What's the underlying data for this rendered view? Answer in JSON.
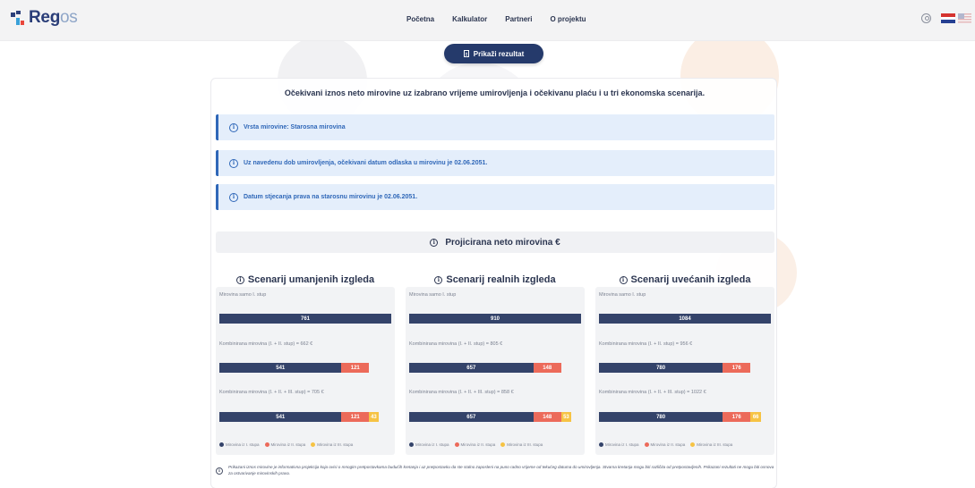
{
  "brand": {
    "logo_part1": "Reg",
    "logo_part2": "os"
  },
  "nav": [
    "Početna",
    "Kalkulator",
    "Partneri",
    "O projektu"
  ],
  "header_icons": [
    "user-icon",
    "flag-hr-icon",
    "flag-en-icon"
  ],
  "result_button": {
    "label": "Prikaži rezultat",
    "icon": "document-icon"
  },
  "intro": "Očekivani iznos neto mirovine uz izabrano vrijeme umirovljenja i očekivanu plaću i u tri ekonomska scenarija.",
  "info_boxes": [
    "Vrsta mirovine: Starosna mirovina",
    "Uz navedenu dob umirovljenja, očekivani datum odlaska u mirovinu je 02.06.2051.",
    "Datum stjecanja prava na starosnu mirovinu je 02.06.2051."
  ],
  "projection_title": "Projicirana neto mirovina €",
  "scenarios": [
    {
      "title": "Scenarij umanjenih izgleda",
      "row1_label": "Mirovina samo I. stup",
      "row1": [
        761
      ],
      "row2_label": "Kombinirana mirovina (I. + II. stup) = 662 €",
      "row2": [
        541,
        121
      ],
      "row3_label": "Kombinirana mirovina (I. + II. + III. stup) = 705 €",
      "row3": [
        541,
        121,
        43
      ]
    },
    {
      "title": "Scenarij realnih izgleda",
      "row1_label": "Mirovina samo I. stup",
      "row1": [
        910
      ],
      "row2_label": "Kombinirana mirovina (I. + II. stup) = 805 €",
      "row2": [
        657,
        148
      ],
      "row3_label": "Kombinirana mirovina (I. + II. + III. stup) = 858 €",
      "row3": [
        657,
        148,
        53
      ]
    },
    {
      "title": "Scenarij uvećanih izgleda",
      "row1_label": "Mirovina samo I. stup",
      "row1": [
        1084
      ],
      "row2_label": "Kombinirana mirovina (I. + II. stup) = 956 €",
      "row2": [
        780,
        176
      ],
      "row3_label": "Kombinirana mirovina (I. + II. + III. stup) = 1022 €",
      "row3": [
        780,
        176,
        66
      ]
    }
  ],
  "legend": [
    "Mirovina iz I. stupa",
    "Mirovina iz II. stupa",
    "Mirovina iz III. stupa"
  ],
  "colors": {
    "stup1": "#34436a",
    "stup2": "#ec6a5a",
    "stup3": "#f6c344",
    "accent": "#253a6b",
    "info": "#2f67b8"
  },
  "disclaimer": "Prikazani iznos mirovine je informativna projekcija koja ovisi o mnogim pretpostavkama budućih kretanja i uz pretpostavku da ste stalno zaposleni na puno radno vrijeme od tekućeg datuma do umirovljenja. Stvarna kretanja mogu biti različita od pretpostavljenih. Prikazani rezultati ne mogu biti osnova za ostvarivanje mirovinskih prava."
}
